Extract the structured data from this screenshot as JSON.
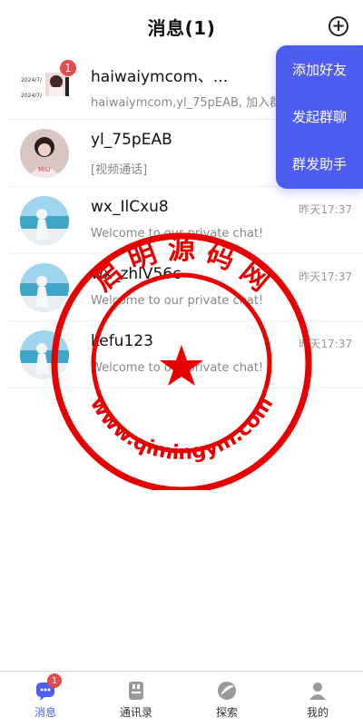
{
  "header": {
    "title": "消息(1)"
  },
  "popup_menu": {
    "items": [
      {
        "label": "添加好友"
      },
      {
        "label": "发起群聊"
      },
      {
        "label": "群发助手"
      }
    ]
  },
  "conversations": [
    {
      "name": "haiwaiymcom、...",
      "message": "haiwaiymcom,yl_75pEAB, 加入群聊",
      "time": "",
      "badge": "1",
      "avatar": "group-avatar"
    },
    {
      "name": "yl_75pEAB",
      "message": "[视频通话]",
      "time": "",
      "badge": "",
      "avatar": "person-avatar"
    },
    {
      "name": "wx_IlCxu8",
      "message": "Welcome to our private chat!",
      "time": "昨天17:37",
      "badge": "",
      "avatar": "beach-avatar"
    },
    {
      "name": "wx_zhlV56c",
      "message": "Welcome to our private chat!",
      "time": "昨天17:37",
      "badge": "",
      "avatar": "beach-avatar"
    },
    {
      "name": "kefu123",
      "message": "Welcome to our private chat!",
      "time": "昨天17:37",
      "badge": "",
      "avatar": "beach-avatar"
    }
  ],
  "group_avatar_text": [
    "2024/7/",
    "2024/7/"
  ],
  "tabbar": {
    "tabs": [
      {
        "label": "消息",
        "icon": "chat-icon",
        "active": true,
        "badge": "1"
      },
      {
        "label": "通讯录",
        "icon": "contacts-icon",
        "active": false
      },
      {
        "label": "探索",
        "icon": "explore-icon",
        "active": false
      },
      {
        "label": "我的",
        "icon": "profile-icon",
        "active": false
      }
    ]
  },
  "watermark": {
    "top_text": "启 明 源 码 网",
    "bottom_text": "www.qimingym.com",
    "color": "#e60000"
  },
  "colors": {
    "accent": "#4c5df0",
    "badge": "#e5484d"
  }
}
